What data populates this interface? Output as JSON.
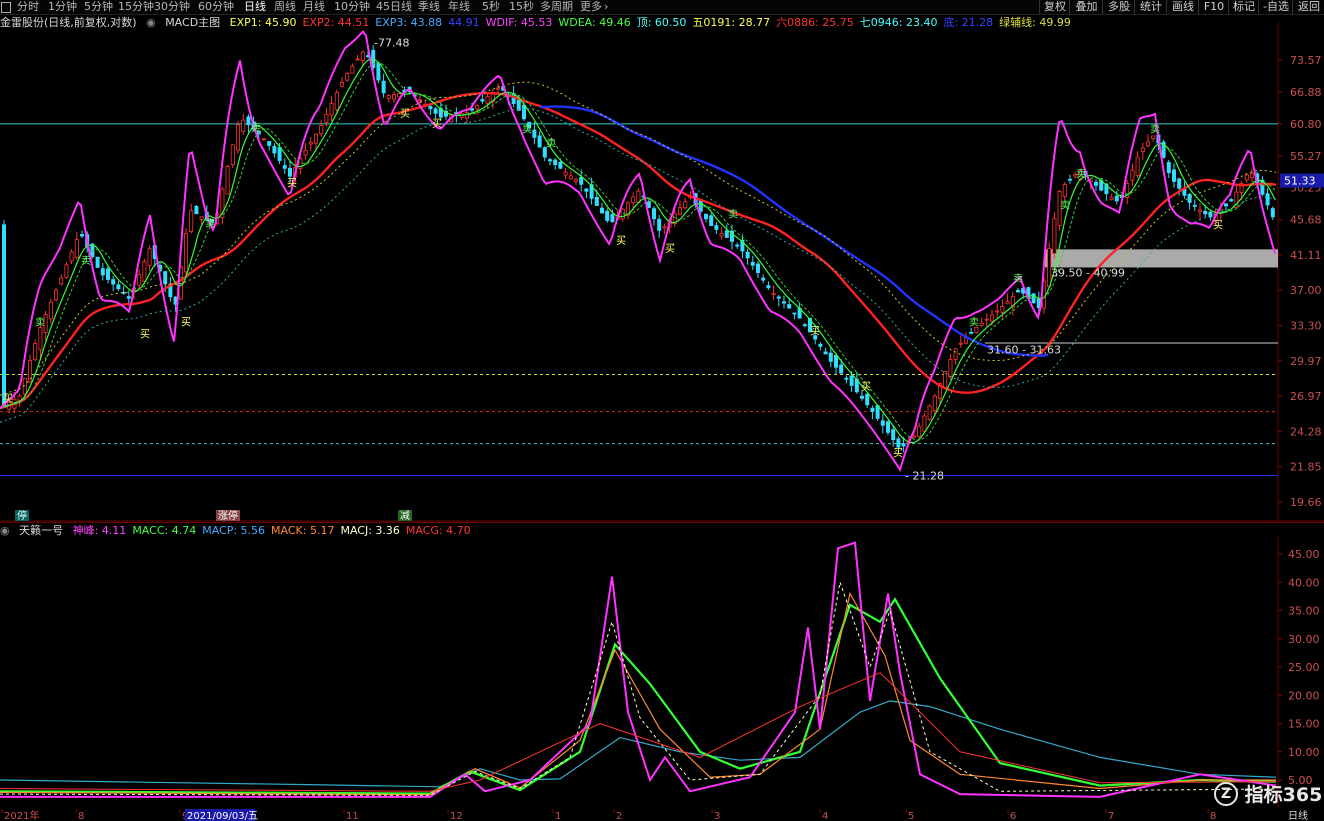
{
  "toolbar": {
    "left_icon": "square-icon",
    "periods": [
      "分时",
      "1分钟",
      "5分钟",
      "15分钟",
      "30分钟",
      "60分钟",
      "日线",
      "周线",
      "月线",
      "10分钟",
      "45日线",
      "季线",
      "年线",
      "5秒",
      "15秒",
      "多周期",
      "更多"
    ],
    "active_period": "日线",
    "more_icon": "chevron-right-icon",
    "right_buttons": [
      "复权",
      "叠加",
      "多股",
      "统计",
      "画线",
      "F10",
      "标记",
      "-自选",
      "返回"
    ]
  },
  "main_legend": {
    "stock": "金雷股份(日线,前复权,对数)",
    "indicator": "MACD主图",
    "items": [
      {
        "label": "EXP1: 45.90",
        "color": "#ffff55"
      },
      {
        "label": "EXP2: 44.51",
        "color": "#ff3333"
      },
      {
        "label": "EXP3: 43.88",
        "color": "#44aaff"
      },
      {
        "label": "44.91",
        "color": "#3344ff"
      },
      {
        "label": "WDIF: 45.53",
        "color": "#ff44ff"
      },
      {
        "label": "WDEA: 49.46",
        "color": "#44ff44"
      },
      {
        "label": "顶: 60.50",
        "color": "#44ffff"
      },
      {
        "label": "五0191: 28.77",
        "color": "#ffff55"
      },
      {
        "label": "六0886: 25.75",
        "color": "#ff3333"
      },
      {
        "label": "七0946: 23.40",
        "color": "#44ffff"
      },
      {
        "label": "底: 21.28",
        "color": "#3344ff"
      },
      {
        "label": "绿辅线: 49.99",
        "color": "#dddd44"
      }
    ]
  },
  "price_axis": [
    "73.57",
    "66.88",
    "60.80",
    "55.27",
    "50.25",
    "45.68",
    "41.11",
    "37.00",
    "33.30",
    "29.97",
    "26.97",
    "24.28",
    "21.85",
    "19.66"
  ],
  "current_price": "51.33",
  "annotations": {
    "high": "77.48",
    "low": "21.28",
    "range1": "39.50 - 40.99",
    "range2": "31.60 - 31.63"
  },
  "signal_labels": {
    "buy": "买",
    "sell": "卖",
    "tag1": "停",
    "tag2": "涨停",
    "tag3": "减"
  },
  "sub_legend": {
    "name": "天籁一号",
    "items": [
      {
        "label": "神峰: 4.11",
        "color": "#ff44ff"
      },
      {
        "label": "MACC: 4.74",
        "color": "#44ff44"
      },
      {
        "label": "MACP: 5.56",
        "color": "#44aaff"
      },
      {
        "label": "MACK: 5.17",
        "color": "#ff8833"
      },
      {
        "label": "MACJ: 3.36",
        "color": "#ffffcc"
      },
      {
        "label": "MACG: 4.70",
        "color": "#ff3333"
      }
    ]
  },
  "sub_axis": [
    "45.00",
    "40.00",
    "35.00",
    "30.00",
    "25.00",
    "20.00",
    "15.00",
    "10.00",
    "5.00"
  ],
  "time_axis": {
    "labels": [
      "2021年",
      "8",
      "9",
      "11",
      "12",
      "1",
      "2",
      "3",
      "4",
      "5",
      "6",
      "7",
      "8"
    ],
    "highlight_date": "2021/09/03/五",
    "period_label": "日线"
  },
  "watermark": "指标365",
  "colors": {
    "background": "#000000",
    "grid_red": "#6a0000",
    "ma_red": "#ff2222",
    "ma_blue": "#2233ff",
    "wdif_magenta": "#ff33ff",
    "wdea_green": "#33ff33"
  }
}
